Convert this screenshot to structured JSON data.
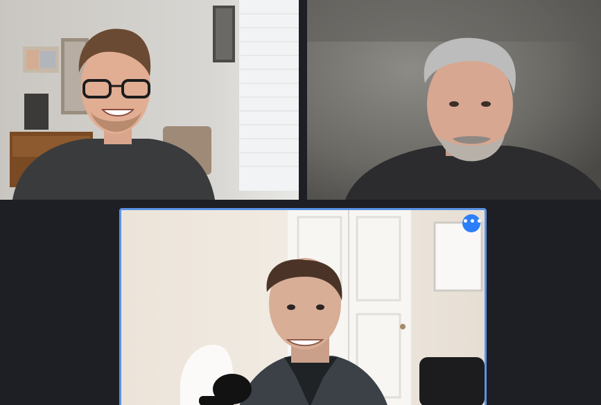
{
  "meeting": {
    "layout": "gallery",
    "participant_count": 3,
    "active_speaker_index": 2
  },
  "participants": [
    {
      "video_label": "participant-video-1",
      "has_video": true
    },
    {
      "video_label": "participant-video-2",
      "has_video": true
    },
    {
      "video_label": "participant-video-3",
      "has_video": true,
      "active_speaker": true
    }
  ],
  "controls": {
    "more_options_label": "•••",
    "more_options_icon": "more-horizontal-icon"
  },
  "colors": {
    "background": "#1e1f24",
    "active_speaker_border": "#5b93e6",
    "more_button": "#2d7ff9"
  }
}
